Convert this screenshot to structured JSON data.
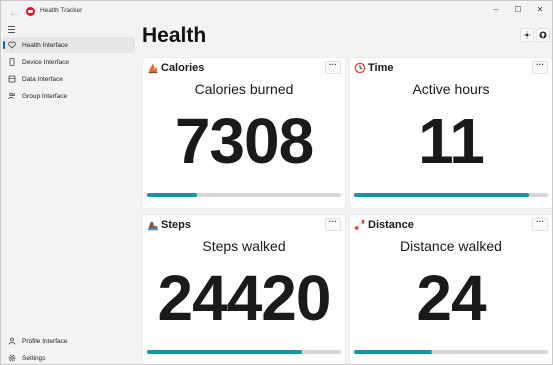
{
  "app": {
    "title": "Health Tracker"
  },
  "window_controls": {
    "minimize": "–",
    "maximize": "☐",
    "close": "✕"
  },
  "nav": {
    "items": [
      {
        "label": "Health Interface",
        "selected": true
      },
      {
        "label": "Device Interface"
      },
      {
        "label": "Data Interface"
      },
      {
        "label": "Group Interface"
      }
    ],
    "footer": [
      {
        "label": "Profile Interface"
      },
      {
        "label": "Settings"
      }
    ]
  },
  "page": {
    "title": "Health",
    "more_label": "···"
  },
  "cards": [
    {
      "title": "Calories",
      "subtitle": "Calories burned",
      "value": "7308",
      "progress": 0.26,
      "icon": "calories-icon"
    },
    {
      "title": "Time",
      "subtitle": "Active hours",
      "value": "11",
      "progress": 0.9,
      "icon": "clock-icon"
    },
    {
      "title": "Steps",
      "subtitle": "Steps walked",
      "value": "24420",
      "progress": 0.8,
      "icon": "steps-icon"
    },
    {
      "title": "Distance",
      "subtitle": "Distance walked",
      "value": "24",
      "progress": 0.4,
      "icon": "distance-icon"
    }
  ],
  "colors": {
    "accent": "#0067c0",
    "progress": "#0e9aa0",
    "progress_track": "#d6d6d6"
  }
}
